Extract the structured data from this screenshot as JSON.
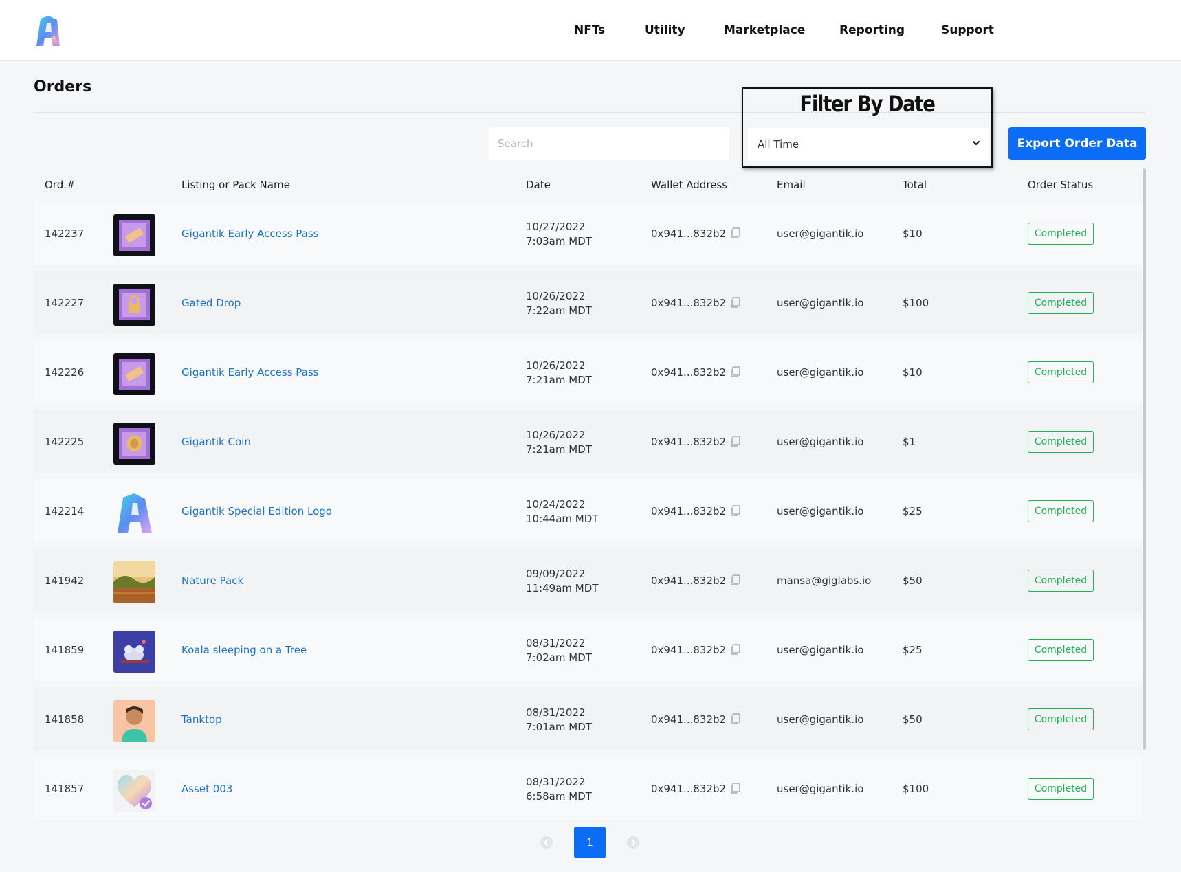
{
  "nav": {
    "items": [
      "NFTs",
      "Utility",
      "Marketplace",
      "Reporting",
      "Support"
    ]
  },
  "page": {
    "title": "Orders"
  },
  "search": {
    "placeholder": "Search",
    "value": ""
  },
  "filter": {
    "heading": "Filter By Date",
    "selected": "All Time"
  },
  "export": {
    "label": "Export Order Data"
  },
  "table": {
    "headers": {
      "ord": "Ord.#",
      "name": "Listing or Pack Name",
      "date": "Date",
      "wallet": "Wallet Address",
      "email": "Email",
      "total": "Total",
      "status": "Order Status"
    },
    "rows": [
      {
        "ord": "142237",
        "thumb": "early-access-pass",
        "name": "Gigantik Early Access Pass",
        "date1": "10/27/2022",
        "date2": "7:03am MDT",
        "wallet": "0x941...832b2",
        "email": "user@gigantik.io",
        "total": "$10",
        "status": "Completed"
      },
      {
        "ord": "142227",
        "thumb": "gated-drop",
        "name": "Gated Drop",
        "date1": "10/26/2022",
        "date2": "7:22am MDT",
        "wallet": "0x941...832b2",
        "email": "user@gigantik.io",
        "total": "$100",
        "status": "Completed"
      },
      {
        "ord": "142226",
        "thumb": "early-access-pass",
        "name": "Gigantik Early Access Pass",
        "date1": "10/26/2022",
        "date2": "7:21am MDT",
        "wallet": "0x941...832b2",
        "email": "user@gigantik.io",
        "total": "$10",
        "status": "Completed"
      },
      {
        "ord": "142225",
        "thumb": "coin",
        "name": "Gigantik Coin",
        "date1": "10/26/2022",
        "date2": "7:21am MDT",
        "wallet": "0x941...832b2",
        "email": "user@gigantik.io",
        "total": "$1",
        "status": "Completed"
      },
      {
        "ord": "142214",
        "thumb": "logo",
        "name": "Gigantik Special Edition Logo",
        "date1": "10/24/2022",
        "date2": "10:44am MDT",
        "wallet": "0x941...832b2",
        "email": "user@gigantik.io",
        "total": "$25",
        "status": "Completed"
      },
      {
        "ord": "141942",
        "thumb": "nature",
        "name": "Nature Pack",
        "date1": "09/09/2022",
        "date2": "11:49am MDT",
        "wallet": "0x941...832b2",
        "email": "mansa@giglabs.io",
        "total": "$50",
        "status": "Completed"
      },
      {
        "ord": "141859",
        "thumb": "koala",
        "name": "Koala sleeping on a Tree",
        "date1": "08/31/2022",
        "date2": "7:02am MDT",
        "wallet": "0x941...832b2",
        "email": "user@gigantik.io",
        "total": "$25",
        "status": "Completed"
      },
      {
        "ord": "141858",
        "thumb": "avatar",
        "name": "Tanktop",
        "date1": "08/31/2022",
        "date2": "7:01am MDT",
        "wallet": "0x941...832b2",
        "email": "user@gigantik.io",
        "total": "$50",
        "status": "Completed"
      },
      {
        "ord": "141857",
        "thumb": "heart",
        "name": "Asset 003",
        "date1": "08/31/2022",
        "date2": "6:58am MDT",
        "wallet": "0x941...832b2",
        "email": "user@gigantik.io",
        "total": "$100",
        "status": "Completed"
      }
    ]
  },
  "pagination": {
    "current": "1"
  },
  "colors": {
    "accent": "#0b6cf5",
    "link": "#1a73c7",
    "success": "#20b254"
  }
}
